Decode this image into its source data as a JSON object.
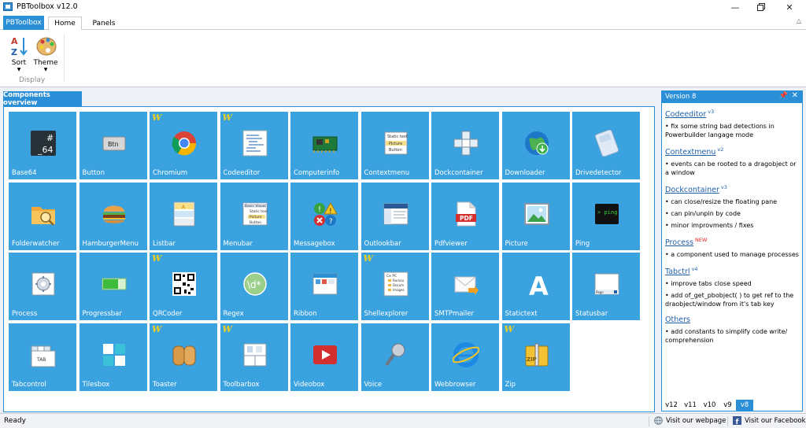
{
  "window": {
    "title": "PBToolbox v12.0"
  },
  "ribbon": {
    "app_tab": "PBToolbox",
    "tabs": [
      "Home",
      "Panels"
    ],
    "buttons": {
      "sort": "Sort",
      "theme": "Theme"
    },
    "group_label": "Display"
  },
  "panel": {
    "title": "Components overview"
  },
  "tiles": [
    {
      "label": "Base64",
      "icon": "base64-icon",
      "w": false
    },
    {
      "label": "Button",
      "icon": "button-icon",
      "w": false
    },
    {
      "label": "Chromium",
      "icon": "chromium-icon",
      "w": true
    },
    {
      "label": "Codeeditor",
      "icon": "codeeditor-icon",
      "w": true
    },
    {
      "label": "Computerinfo",
      "icon": "computerinfo-icon",
      "w": false
    },
    {
      "label": "Contextmenu",
      "icon": "contextmenu-icon",
      "w": false
    },
    {
      "label": "Dockcontainer",
      "icon": "dockcontainer-icon",
      "w": false
    },
    {
      "label": "Downloader",
      "icon": "downloader-icon",
      "w": false
    },
    {
      "label": "Drivedetector",
      "icon": "drivedetector-icon",
      "w": false
    },
    {
      "label": "Folderwatcher",
      "icon": "folderwatcher-icon",
      "w": false
    },
    {
      "label": "HamburgerMenu",
      "icon": "hamburgermenu-icon",
      "w": false
    },
    {
      "label": "Listbar",
      "icon": "listbar-icon",
      "w": false
    },
    {
      "label": "Menubar",
      "icon": "menubar-icon",
      "w": false
    },
    {
      "label": "Messagebox",
      "icon": "messagebox-icon",
      "w": false
    },
    {
      "label": "Outlookbar",
      "icon": "outlookbar-icon",
      "w": false
    },
    {
      "label": "Pdfviewer",
      "icon": "pdfviewer-icon",
      "w": false
    },
    {
      "label": "Picture",
      "icon": "picture-icon",
      "w": false
    },
    {
      "label": "Ping",
      "icon": "ping-icon",
      "w": false
    },
    {
      "label": "Process",
      "icon": "process-icon",
      "w": false
    },
    {
      "label": "Progressbar",
      "icon": "progressbar-icon",
      "w": false
    },
    {
      "label": "QRCoder",
      "icon": "qrcoder-icon",
      "w": true
    },
    {
      "label": "Regex",
      "icon": "regex-icon",
      "w": false
    },
    {
      "label": "Ribbon",
      "icon": "ribbon-icon",
      "w": false
    },
    {
      "label": "Shellexplorer",
      "icon": "shellexplorer-icon",
      "w": true
    },
    {
      "label": "SMTPmailer",
      "icon": "smtpmailer-icon",
      "w": false
    },
    {
      "label": "Statictext",
      "icon": "statictext-icon",
      "w": false
    },
    {
      "label": "Statusbar",
      "icon": "statusbar-icon",
      "w": false
    },
    {
      "label": "Tabcontrol",
      "icon": "tabcontrol-icon",
      "w": false
    },
    {
      "label": "Tilesbox",
      "icon": "tilesbox-icon",
      "w": false
    },
    {
      "label": "Toaster",
      "icon": "toaster-icon",
      "w": true
    },
    {
      "label": "Toolbarbox",
      "icon": "toolbarbox-icon",
      "w": true
    },
    {
      "label": "Videobox",
      "icon": "videobox-icon",
      "w": false
    },
    {
      "label": "Voice",
      "icon": "voice-icon",
      "w": false
    },
    {
      "label": "Webbrowser",
      "icon": "webbrowser-icon",
      "w": false
    },
    {
      "label": "Zip",
      "icon": "zip-icon",
      "w": true
    }
  ],
  "w_badge": "W",
  "version": {
    "title": "Version 8",
    "notes": [
      {
        "title": "Codeeditor",
        "sup": "v3",
        "new": false,
        "items": [
          "fix some string bad detections in Powerbuilder langage mode"
        ]
      },
      {
        "title": "Contextmenu",
        "sup": "v2",
        "new": false,
        "items": [
          "events can be rooted to a dragobject or a window"
        ]
      },
      {
        "title": "Dockcontainer",
        "sup": "v3",
        "new": false,
        "items": [
          "can close/resize the floating pane",
          "can pin/unpin by code",
          "minor improvments / fixes"
        ]
      },
      {
        "title": "Process",
        "sup": "NEW",
        "new": true,
        "items": [
          "a component used to manage processes"
        ]
      },
      {
        "title": "Tabctrl",
        "sup": "v4",
        "new": false,
        "items": [
          "improve tabs close speed",
          "add of_get_pbobject( ) to get ref to the draobject/window from it's tab key"
        ]
      },
      {
        "title": "Others",
        "sup": "",
        "new": false,
        "items": [
          "add constants to simplify code write/ comprehension"
        ]
      }
    ],
    "tabs": [
      "v12",
      "v11",
      "v10",
      "v9",
      "v8"
    ],
    "active_tab": "v8"
  },
  "statusbar": {
    "status": "Ready",
    "webpage": "Visit our webpage",
    "facebook": "Visit our Facebook"
  },
  "colors": {
    "accent": "#2b8fd8",
    "tile": "#3ba2e0",
    "badge": "#f2cf1c"
  }
}
